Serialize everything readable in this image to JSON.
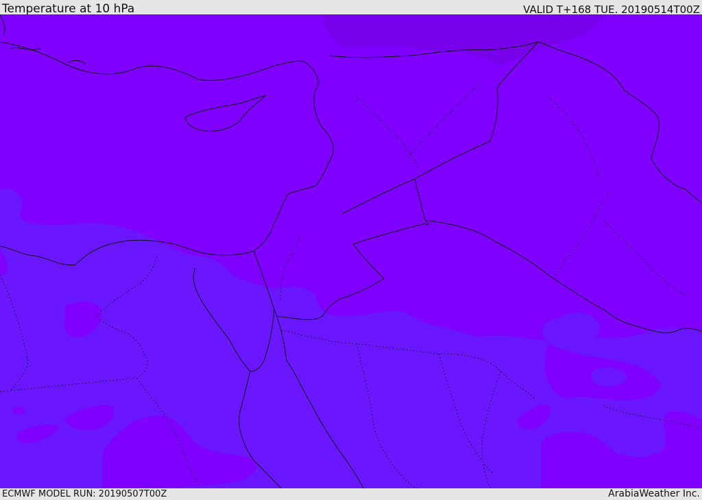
{
  "header": {
    "title": "Temperature at 10 hPa",
    "valid": "VALID T+168 TUE. 20190514T00Z"
  },
  "footer": {
    "model_run": "ECMWF MODEL RUN: 20190507T00Z",
    "credit": "ArabiaWeather Inc."
  },
  "map": {
    "colors": {
      "warm_band": "#7f00ff",
      "cool_band": "#6a16ff",
      "cold_patch": "#7a00e8",
      "coastline": "#111111"
    }
  }
}
